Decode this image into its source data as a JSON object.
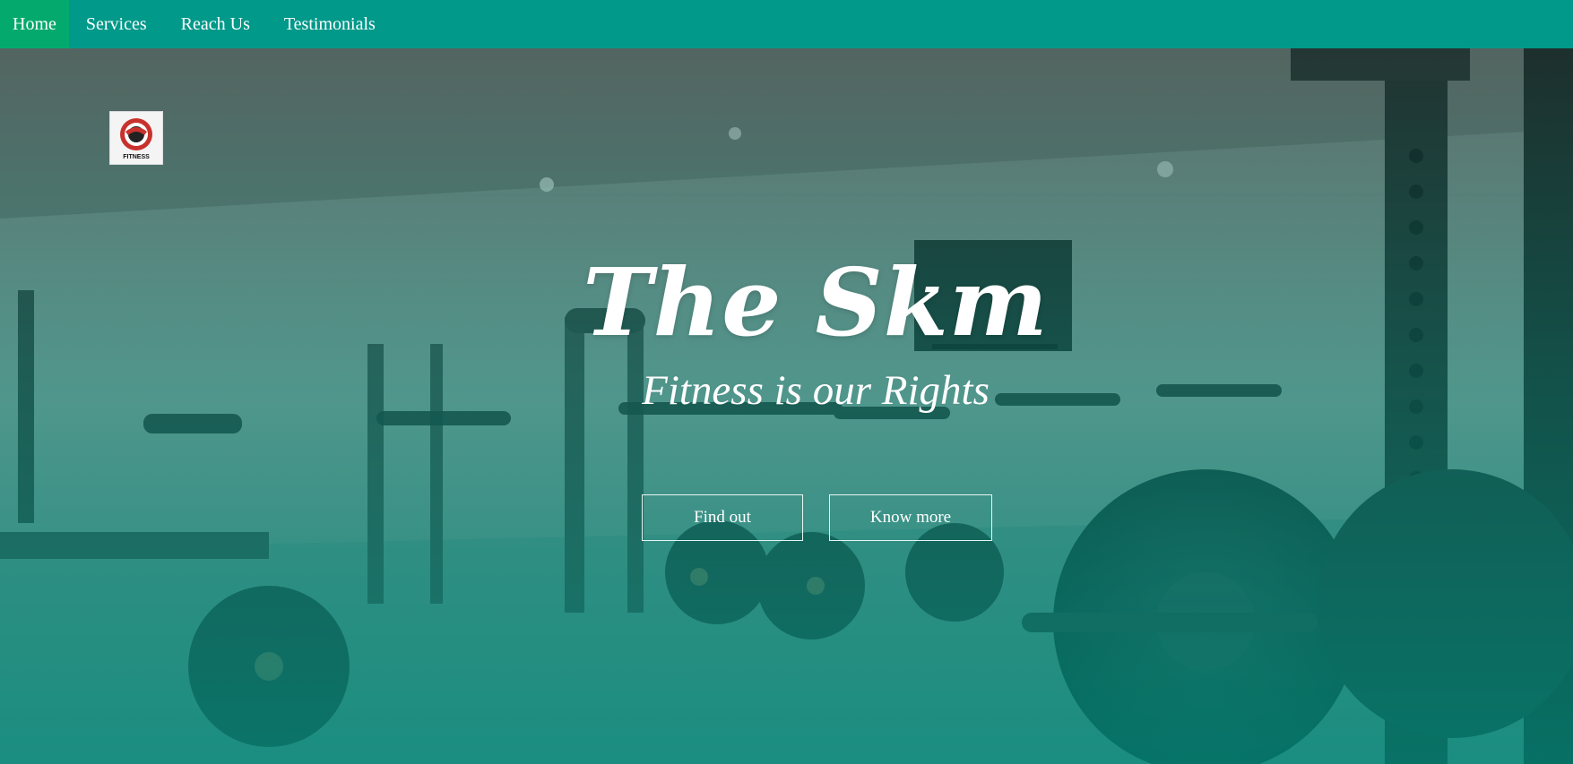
{
  "nav": {
    "items": [
      {
        "label": "Home",
        "active": true
      },
      {
        "label": "Services",
        "active": false
      },
      {
        "label": "Reach Us",
        "active": false
      },
      {
        "label": "Testimonials",
        "active": false
      }
    ]
  },
  "logo": {
    "caption": "FITNESS"
  },
  "hero": {
    "title": "The Skm",
    "tagline": "Fitness is our Rights",
    "buttons": {
      "find_out": "Find out",
      "know_more": "Know more"
    }
  },
  "colors": {
    "navbar": "#00998a",
    "nav_active": "#04aa6d",
    "overlay_teal": "#008c7d",
    "text": "#ffffff"
  }
}
